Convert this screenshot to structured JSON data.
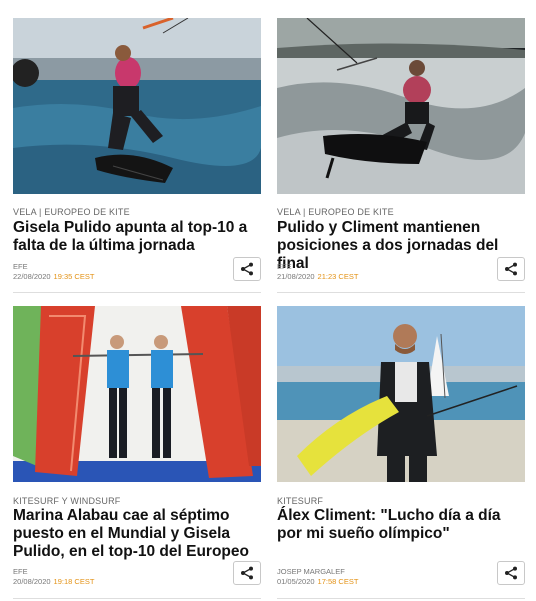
{
  "articles": [
    {
      "kicker": "VELA | EUROPEO DE KITE",
      "title": "Gisela Pulido apunta al top-10 a falta de la última jornada",
      "source": "EFE",
      "date": "22/08/2020",
      "time": "19:35 CEST"
    },
    {
      "kicker": "VELA | EUROPEO DE KITE",
      "title": "Pulido y Climent mantienen posiciones a dos jornadas del final",
      "source": "EFE",
      "date": "21/08/2020",
      "time": "21:23 CEST"
    },
    {
      "kicker": "KITESURF Y WINDSURF",
      "title": "Marina Alabau cae al séptimo puesto en el Mundial y Gisela Pulido, en el top-10 del Europeo",
      "source": "EFE",
      "date": "20/08/2020",
      "time": "19:18 CEST"
    },
    {
      "kicker": "KITESURF",
      "title": "Álex Climent: \"Lucho día a día por mi sueño olímpico\"",
      "source": "JOSEP MARGALEF",
      "date": "01/05/2020",
      "time": "17:58 CEST"
    }
  ],
  "icons": {
    "share": "share-icon"
  },
  "colors": {
    "time": "#e39216",
    "kicker": "#666666",
    "title": "#111111"
  }
}
